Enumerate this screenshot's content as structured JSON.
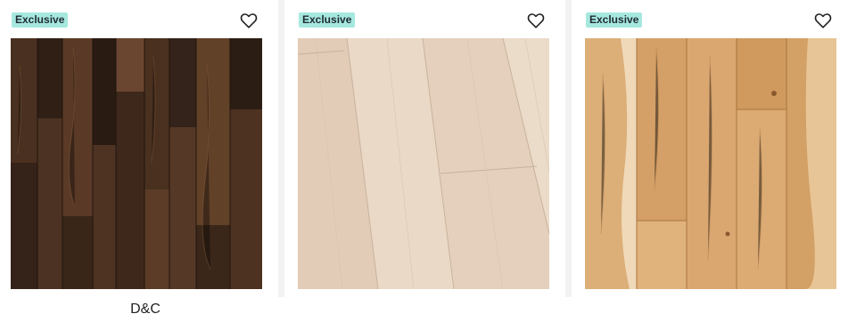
{
  "products": [
    {
      "badge": "Exclusive",
      "icon": "heart-outline-icon",
      "swatch": "dark distressed hickory",
      "caption": "D&C"
    },
    {
      "badge": "Exclusive",
      "icon": "heart-outline-icon",
      "swatch": "light whitewashed oak",
      "caption": ""
    },
    {
      "badge": "Exclusive",
      "icon": "heart-outline-icon",
      "swatch": "natural hickory",
      "caption": ""
    }
  ],
  "colors": {
    "badge_bg": "#a6e8df",
    "badge_text": "#1f2a33",
    "gutter": "#f2f2f2"
  }
}
